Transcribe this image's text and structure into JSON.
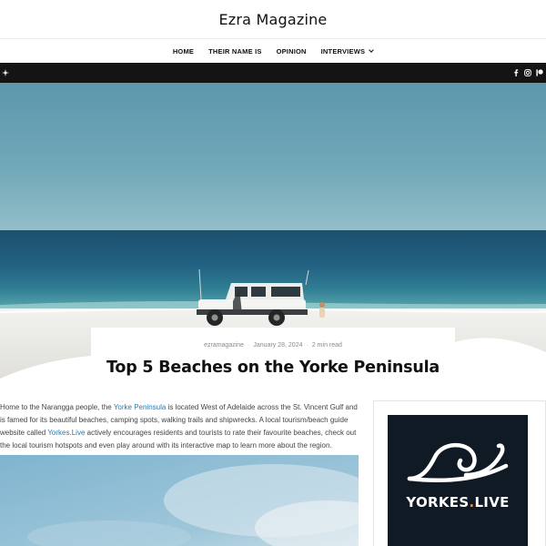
{
  "site": {
    "title": "Ezra Magazine"
  },
  "nav": {
    "items": [
      {
        "label": "HOME"
      },
      {
        "label": "THEIR NAME IS"
      },
      {
        "label": "OPINION"
      },
      {
        "label": "INTERVIEWS"
      }
    ]
  },
  "topbar": {
    "left_icon": "sparkle-icon",
    "social_icons": [
      "facebook-icon",
      "instagram-icon",
      "patreon-icon"
    ]
  },
  "post": {
    "author": "ezramagazine",
    "date": "January 28, 2024",
    "read_time": "2 min read",
    "title": "Top 5 Beaches on the Yorke Peninsula",
    "body": {
      "p1": "Home to the Narangga people, the ",
      "link1": "Yorke Peninsula",
      "p2": " is located West of Adelaide across the St. Vincent Gulf and is famed for its beautiful beaches, camping spots, walking trails and shipwrecks. A local tourism/beach guide website called ",
      "link2": "Yorkes.Live",
      "p3": " actively encourages residents and tourists to rate their favourite beaches, check out the local tourism hotspots and even play around with its interactive map to learn more about the region."
    }
  },
  "sidebar": {
    "ad": {
      "brand": "YORKES",
      "dot": ".",
      "suffix": "LIVE",
      "icon": "wave-icon"
    }
  },
  "colors": {
    "link": "#2a7ab0",
    "topbar": "#141414",
    "ad_bg": "#0f1a24",
    "ad_dot": "#f28c1e"
  }
}
